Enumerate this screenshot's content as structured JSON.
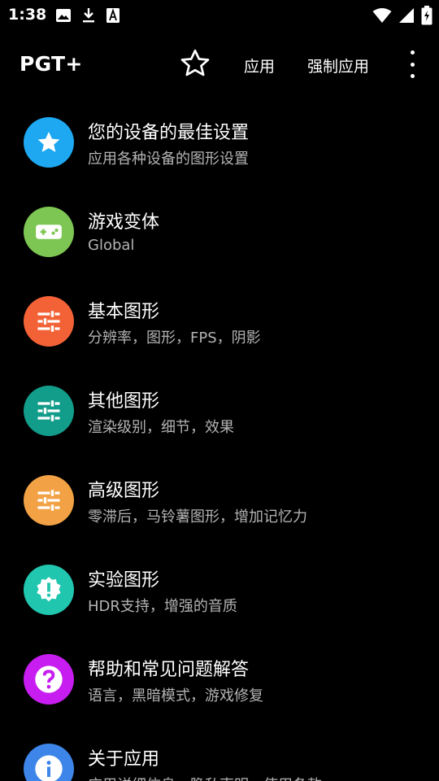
{
  "status_bar": {
    "time": "1:38",
    "left_icons": [
      "image-icon",
      "download-icon",
      "font-a-icon"
    ],
    "right_icons": [
      "wifi-icon",
      "signal-icon",
      "battery-charging-icon"
    ]
  },
  "app_bar": {
    "title": "PGT+",
    "favorite_icon": "star-outline-icon",
    "apply_label": "应用",
    "force_apply_label": "强制应用",
    "overflow_icon": "more-vert-icon"
  },
  "menu": {
    "items": [
      {
        "title": "您的设备的最佳设置",
        "subtitle": "应用各种设备的图形设置",
        "icon": "star-icon",
        "color": "#1EA8F2"
      },
      {
        "title": "游戏变体",
        "subtitle": "Global",
        "icon": "gamepad-icon",
        "color": "#7DC653"
      },
      {
        "title": "基本图形",
        "subtitle": "分辨率，图形，FPS，阴影",
        "icon": "sliders-icon",
        "color": "#F26236"
      },
      {
        "title": "其他图形",
        "subtitle": "渲染级别，细节，效果",
        "icon": "sliders-icon",
        "color": "#129C8A"
      },
      {
        "title": "高级图形",
        "subtitle": "零滞后，马铃薯图形，增加记忆力",
        "icon": "sliders-icon",
        "color": "#F2A245"
      },
      {
        "title": "实验图形",
        "subtitle": "HDR支持，增强的音质",
        "icon": "alert-badge-icon",
        "color": "#21C6AF"
      },
      {
        "title": "帮助和常见问题解答",
        "subtitle": "语言，黑暗模式，游戏修复",
        "icon": "help-icon",
        "color": "#C71DF0"
      },
      {
        "title": "关于应用",
        "subtitle": "应用详细信息，隐私声明，使用条款",
        "icon": "info-icon",
        "color": "#3D85E8"
      }
    ]
  }
}
